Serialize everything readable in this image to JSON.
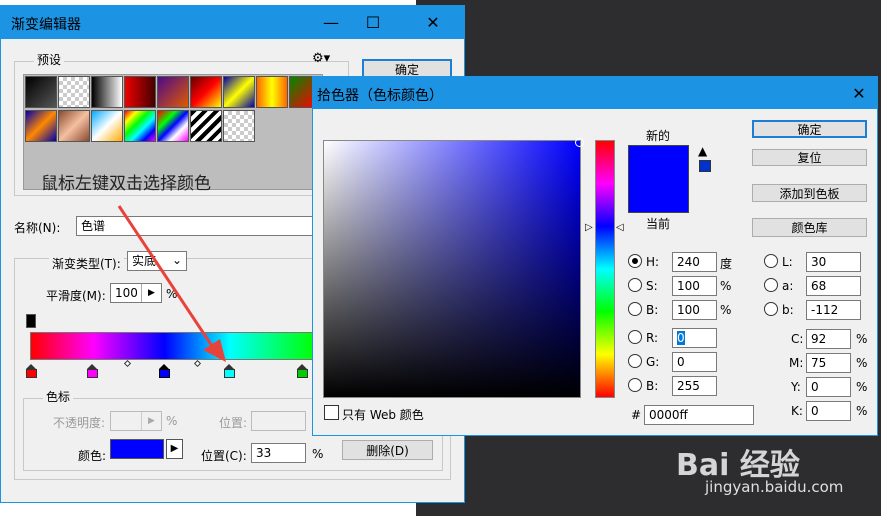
{
  "gradient_editor": {
    "title": "渐变编辑器",
    "minimize": "—",
    "maximize": "☐",
    "close": "✕",
    "presets_label": "预设",
    "presets_menu_icon": "gear-icon",
    "hint_text": "鼠标左键双击选择颜色",
    "ok_label": "确定",
    "name_label": "名称(N):",
    "name_value": "色谱",
    "gradient_type_label": "渐变类型(T):",
    "gradient_type_value": "实底",
    "smoothness_label": "平滑度(M):",
    "smoothness_value": "100",
    "smoothness_unit": "%",
    "color_stops_label": "色标",
    "opacity_label": "不透明度:",
    "opacity_unit": "%",
    "location_label_disabled": "位置:",
    "color_label": "颜色:",
    "location_label": "位置(C):",
    "location_value": "33",
    "location_unit": "%",
    "delete_label": "删除(D)",
    "stop_colors": [
      "#ff0000",
      "#ff00ff",
      "#0000ff",
      "#00ffff",
      "#00ff00"
    ],
    "current_color": "#0000ff"
  },
  "color_picker": {
    "title": "拾色器（色标颜色）",
    "close": "✕",
    "new_label": "新的",
    "current_label": "当前",
    "new_color": "#0000ff",
    "current_color": "#0000ff",
    "ok_label": "确定",
    "reset_label": "复位",
    "add_swatch_label": "添加到色板",
    "color_library_label": "颜色库",
    "web_only_label": "只有 Web 颜色",
    "hue_deg": 240,
    "fields": {
      "H": {
        "label": "H:",
        "value": "240",
        "unit": "度"
      },
      "S": {
        "label": "S:",
        "value": "100",
        "unit": "%"
      },
      "B": {
        "label": "B:",
        "value": "100",
        "unit": "%"
      },
      "R": {
        "label": "R:",
        "value": "0"
      },
      "G": {
        "label": "G:",
        "value": "0"
      },
      "B2": {
        "label": "B:",
        "value": "255"
      },
      "L": {
        "label": "L:",
        "value": "30"
      },
      "a": {
        "label": "a:",
        "value": "68"
      },
      "b": {
        "label": "b:",
        "value": "-112"
      },
      "C": {
        "label": "C:",
        "value": "92",
        "unit": "%"
      },
      "M": {
        "label": "M:",
        "value": "75",
        "unit": "%"
      },
      "Y": {
        "label": "Y:",
        "value": "0",
        "unit": "%"
      },
      "K": {
        "label": "K:",
        "value": "0",
        "unit": "%"
      }
    },
    "hex_label": "#",
    "hex_value": "0000ff"
  },
  "watermark": {
    "brand": "Bai 经验",
    "url": "jingyan.baidu.com"
  }
}
